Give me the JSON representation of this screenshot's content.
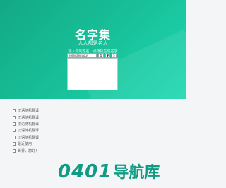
{
  "header": {
    "title": "名字集",
    "subtitle": "人人都是名人",
    "hint": "输入你的姓名，点随机生成名字",
    "input_value": "ereecaegyouy",
    "selects": [
      "女",
      "▼",
      "5"
    ]
  },
  "links": [
    "汉语随机翻译",
    "汉语随机翻译",
    "汉语随机翻译",
    "汉语随机翻译",
    "汉语随机翻译",
    "最近使用",
    "世界，您好！"
  ],
  "watermark": {
    "number": "0401",
    "text": "导航库"
  }
}
